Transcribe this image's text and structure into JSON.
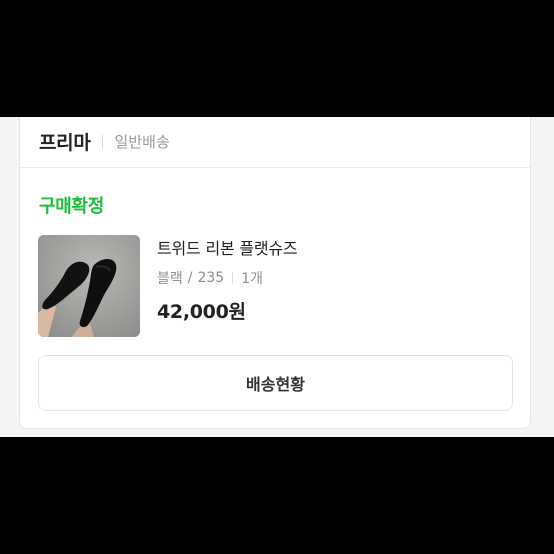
{
  "order": {
    "seller_name": "프리마",
    "shipping_type": "일반배송",
    "status": "구매확정",
    "status_color": "#1fbe3c"
  },
  "product": {
    "image": "product-photo-black-sock-boots",
    "name": "트위드 리본 플랫슈즈",
    "color": "블랙",
    "size_sep": "/",
    "size": "235",
    "quantity": "1개",
    "price": "42,000원"
  },
  "actions": {
    "track_label": "배송현황"
  }
}
